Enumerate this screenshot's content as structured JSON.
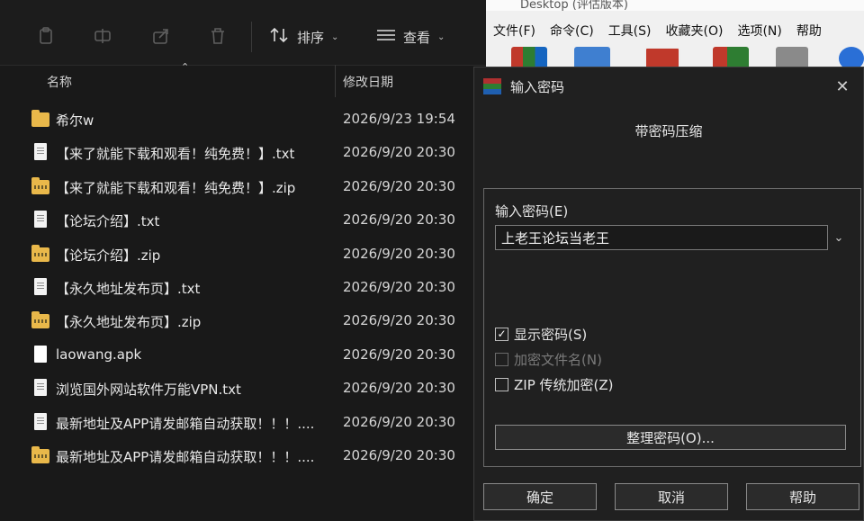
{
  "explorer": {
    "toolbar": {
      "sort_label": "排序",
      "view_label": "查看"
    },
    "columns": {
      "name": "名称",
      "date": "修改日期"
    },
    "files": [
      {
        "name": "希尔w",
        "date": "2026/9/23 19:54",
        "icon": "folder-icon"
      },
      {
        "name": "【来了就能下载和观看！纯免费！】.txt",
        "date": "2026/9/20 20:30",
        "icon": "text-file-icon"
      },
      {
        "name": "【来了就能下载和观看！纯免费！】.zip",
        "date": "2026/9/20 20:30",
        "icon": "zip-folder-icon"
      },
      {
        "name": "【论坛介绍】.txt",
        "date": "2026/9/20 20:30",
        "icon": "text-file-icon"
      },
      {
        "name": "【论坛介绍】.zip",
        "date": "2026/9/20 20:30",
        "icon": "zip-folder-icon"
      },
      {
        "name": "【永久地址发布页】.txt",
        "date": "2026/9/20 20:30",
        "icon": "text-file-icon"
      },
      {
        "name": "【永久地址发布页】.zip",
        "date": "2026/9/20 20:30",
        "icon": "zip-folder-icon"
      },
      {
        "name": "laowang.apk",
        "date": "2026/9/20 20:30",
        "icon": "apk-file-icon"
      },
      {
        "name": "浏览国外网站软件万能VPN.txt",
        "date": "2026/9/20 20:30",
        "icon": "text-file-icon"
      },
      {
        "name": "最新地址及APP请发邮箱自动获取！！！....",
        "date": "2026/9/20 20:30",
        "icon": "text-file-icon"
      },
      {
        "name": "最新地址及APP请发邮箱自动获取！！！....",
        "date": "2026/9/20 20:30",
        "icon": "zip-folder-icon"
      }
    ]
  },
  "winrar": {
    "title": "Desktop (评估版本)",
    "menu": [
      "文件(F)",
      "命令(C)",
      "工具(S)",
      "收藏夹(O)",
      "选项(N)",
      "帮助"
    ]
  },
  "dialog": {
    "title": "输入密码",
    "heading": "带密码压缩",
    "password_label": "输入密码(E)",
    "password_value": "上老王论坛当老王",
    "show_password": {
      "label": "显示密码(S)",
      "checked": true
    },
    "encrypt_names": {
      "label": "加密文件名(N)",
      "checked": false,
      "disabled": true
    },
    "zip_legacy": {
      "label": "ZIP 传统加密(Z)",
      "checked": false
    },
    "organize_button": "整理密码(O)...",
    "ok_button": "确定",
    "cancel_button": "取消",
    "help_button": "帮助"
  },
  "colors": {
    "explorer_bg": "#191919",
    "dialog_bg": "#202020",
    "folder": "#e9b84a",
    "text": "#e6e6e6"
  }
}
